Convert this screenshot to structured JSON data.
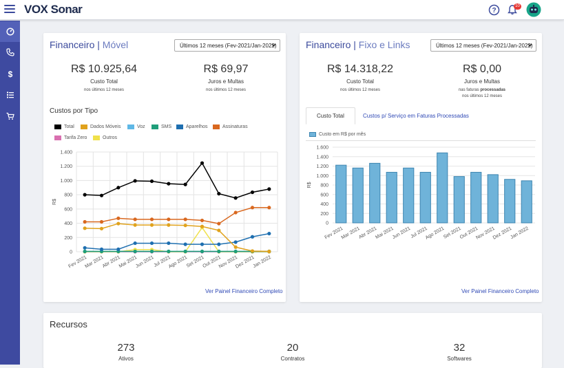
{
  "header": {
    "logo": "VOX Sonar",
    "notification_count": "10"
  },
  "colors": {
    "sidebar": "#3e4aa0",
    "accent": "#3b4a9c",
    "link": "#2f49b5"
  },
  "sidebar": {
    "items": [
      {
        "icon": "dashboard-icon"
      },
      {
        "icon": "phone-icon"
      },
      {
        "icon": "dollar-icon"
      },
      {
        "icon": "list-icon"
      },
      {
        "icon": "cart-icon"
      }
    ]
  },
  "movel": {
    "title": "Financeiro",
    "title_sub": "Móvel",
    "period": "Últimos 12 meses (Fev-2021/Jan-2022)",
    "kpi1": {
      "value": "R$ 10.925,64",
      "label": "Custo Total",
      "sub": "nos últimos 12 meses"
    },
    "kpi2": {
      "value": "R$ 69,97",
      "label": "Juros e Multas",
      "sub": "nos últimos 12 meses"
    },
    "chart_title": "Custos por Tipo",
    "link": "Ver Painel Financeiro Completo"
  },
  "fixo": {
    "title": "Financeiro",
    "title_sub": "Fixo e Links",
    "period": "Últimos 12 meses (Fev-2021/Jan-2022)",
    "kpi1": {
      "value": "R$ 14.318,22",
      "label": "Custo Total",
      "sub": "nos últimos 12 meses"
    },
    "kpi2": {
      "value": "R$ 0,00",
      "label": "Juros e Multas",
      "sub_pre": "nas faturas ",
      "sub_bold": "processadas",
      "sub2": "nos últimos 12 meses"
    },
    "tabs": [
      "Custo Total",
      "Custos p/ Serviço em Faturas Processadas"
    ],
    "link": "Ver Painel Financeiro Completo"
  },
  "recursos": {
    "title": "Recursos",
    "items": [
      {
        "value": "273",
        "label": "Ativos"
      },
      {
        "value": "20",
        "label": "Contratos"
      },
      {
        "value": "32",
        "label": "Softwares"
      }
    ]
  },
  "chart_data": [
    {
      "type": "line",
      "title": "Custos por Tipo",
      "ylabel": "R$",
      "ylim": [
        0,
        1400
      ],
      "yticks": [
        "0",
        "200",
        "400",
        "600",
        "800",
        "1.000",
        "1.200",
        "1.400"
      ],
      "categories": [
        "Fev 2021",
        "Mar 2021",
        "Abr 2021",
        "Mai 2021",
        "Jun 2021",
        "Jul 2021",
        "Ago 2021",
        "Set 2021",
        "Out 2021",
        "Nov 2021",
        "Dez 2021",
        "Jan 2022"
      ],
      "legend_placement": "top",
      "series": [
        {
          "name": "Total",
          "color": "#000000",
          "values": [
            800,
            790,
            900,
            995,
            990,
            955,
            945,
            1245,
            815,
            755,
            835,
            880
          ]
        },
        {
          "name": "Dados Móveis",
          "color": "#e0a21c",
          "values": [
            330,
            325,
            395,
            375,
            375,
            375,
            370,
            355,
            300,
            65,
            10,
            5
          ]
        },
        {
          "name": "Voz",
          "color": "#5fb8e6",
          "values": [
            5,
            5,
            5,
            5,
            5,
            5,
            5,
            5,
            5,
            5,
            5,
            5
          ]
        },
        {
          "name": "SMS",
          "color": "#1f9e7a",
          "values": [
            5,
            5,
            5,
            5,
            5,
            5,
            5,
            5,
            5,
            5,
            5,
            5
          ]
        },
        {
          "name": "Aparelhos",
          "color": "#1e6fb0",
          "values": [
            55,
            35,
            35,
            120,
            120,
            120,
            105,
            105,
            105,
            135,
            210,
            255
          ]
        },
        {
          "name": "Assinaturas",
          "color": "#d9681f",
          "values": [
            420,
            420,
            470,
            455,
            455,
            455,
            455,
            440,
            395,
            550,
            620,
            620
          ]
        },
        {
          "name": "Tarifa Zero",
          "color": "#d970b0",
          "values": [
            0,
            0,
            0,
            0,
            0,
            0,
            0,
            0,
            0,
            0,
            0,
            0
          ]
        },
        {
          "name": "Outros",
          "color": "#f0e14a",
          "values": [
            0,
            0,
            0,
            30,
            30,
            0,
            0,
            340,
            0,
            0,
            0,
            0
          ]
        }
      ]
    },
    {
      "type": "bar",
      "ylabel": "R$",
      "ylim": [
        0,
        1600
      ],
      "yticks": [
        "0",
        "200",
        "400",
        "600",
        "800",
        "1.000",
        "1.200",
        "1.400",
        "1.600"
      ],
      "categories": [
        "Fev 2021",
        "Mar 2021",
        "Abr 2021",
        "Mai 2021",
        "Jun 2021",
        "Jul 2021",
        "Ago 2021",
        "Set 2021",
        "Out 2021",
        "Nov 2021",
        "Dez 2021",
        "Jan 2022"
      ],
      "legend_placement": "top-left",
      "series": [
        {
          "name": "Custo em R$ por mês",
          "color": "#6fb3d9",
          "values": [
            1220,
            1160,
            1260,
            1070,
            1160,
            1070,
            1480,
            980,
            1070,
            1020,
            920,
            890
          ]
        }
      ]
    }
  ]
}
